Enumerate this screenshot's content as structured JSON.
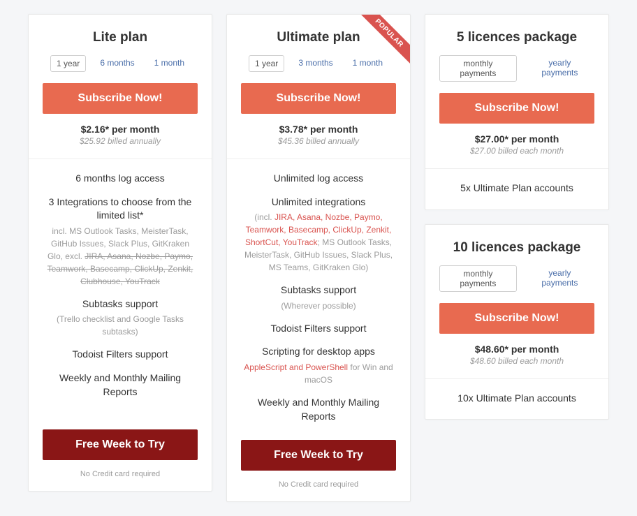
{
  "buttons": {
    "subscribe": "Subscribe Now!",
    "free_week": "Free Week to Try",
    "no_cc": "No Credit card required"
  },
  "lite": {
    "title": "Lite plan",
    "tabs": [
      "1 year",
      "6 months",
      "1 month"
    ],
    "price": "$2.16* per month",
    "billed": "$25.92 billed annually",
    "f1": "6 months log access",
    "f2": "3 Integrations to choose from the limited list*",
    "f2sub_a": "incl. MS Outlook Tasks, MeisterTask, GitHub Issues, Slack Plus, GitKraken Glo, excl. ",
    "f2sub_b": "JIRA, Asana, Nozbe, Paymo, Teamwork, Basecamp, ClickUp, Zenkit, Clubhouse, YouTrack",
    "f3": "Subtasks support",
    "f3sub": "(Trello checklist and Google Tasks subtasks)",
    "f4": "Todoist Filters support",
    "f5": "Weekly and Monthly Mailing Reports"
  },
  "ultimate": {
    "title": "Ultimate plan",
    "ribbon": "POPULAR",
    "tabs": [
      "1 year",
      "3 months",
      "1 month"
    ],
    "price": "$3.78* per month",
    "billed": "$45.36 billed annually",
    "f1": "Unlimited log access",
    "f2": "Unlimited integrations",
    "f2sub_a": "(incl. ",
    "f2sub_b": "JIRA, Asana, Nozbe, Paymo, Teamwork, Basecamp, ClickUp, Zenkit, ShortCut, YouTrack",
    "f2sub_c": "; MS Outlook Tasks, MeisterTask, GitHub Issues, Slack Plus, MS Teams, GitKraken Glo)",
    "f3": "Subtasks support",
    "f3sub": "(Wherever possible)",
    "f4": "Todoist Filters support",
    "f5": "Scripting for desktop apps",
    "f5sub_a": "AppleScript and PowerShell",
    "f5sub_b": " for Win and macOS",
    "f6": "Weekly and Monthly Mailing Reports"
  },
  "pkg5": {
    "title": "5 licences package",
    "tabs": [
      "monthly payments",
      "yearly payments"
    ],
    "price": "$27.00* per month",
    "billed": "$27.00 billed each month",
    "f1": "5x Ultimate Plan accounts"
  },
  "pkg10": {
    "title": "10 licences package",
    "tabs": [
      "monthly payments",
      "yearly payments"
    ],
    "price": "$48.60* per month",
    "billed": "$48.60 billed each month",
    "f1": "10x Ultimate Plan accounts"
  }
}
